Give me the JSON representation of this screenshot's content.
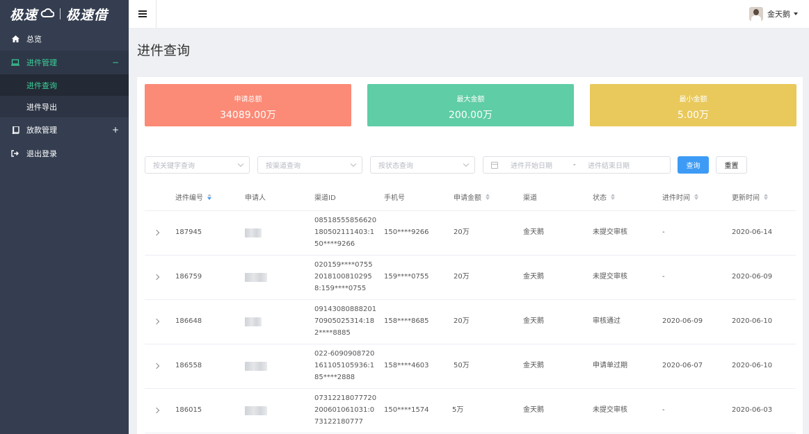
{
  "sidebar": {
    "logo_left": "极速",
    "logo_right": "极速借",
    "items": [
      {
        "label": "总览",
        "icon": "home-icon"
      },
      {
        "label": "进件管理",
        "icon": "laptop-icon",
        "toggle": "−"
      },
      {
        "label": "放款管理",
        "icon": "book-icon",
        "toggle": "+"
      },
      {
        "label": "退出登录",
        "icon": "logout-icon"
      }
    ],
    "sub_items": [
      {
        "label": "进件查询"
      },
      {
        "label": "进件导出"
      }
    ]
  },
  "topbar": {
    "user_name": "金天鹅"
  },
  "page_title": "进件查询",
  "colors": {
    "card_total": "#fb8a76",
    "card_max": "#5fcda6",
    "card_min": "#e9c95b",
    "accent": "#3bd19a",
    "primary_button": "#3e9bf5"
  },
  "summary": {
    "total": {
      "label": "申请总额",
      "value": "34089.00万"
    },
    "max": {
      "label": "最大金额",
      "value": "200.00万"
    },
    "min": {
      "label": "最小金额",
      "value": "5.00万"
    }
  },
  "filters": {
    "keyword_placeholder": "按关键字查询",
    "channel_placeholder": "按渠道查询",
    "status_placeholder": "按状态查询",
    "start_date_placeholder": "进件开始日期",
    "date_separator": "-",
    "end_date_placeholder": "进件结束日期",
    "search_label": "查询",
    "reset_label": "重置"
  },
  "table": {
    "headers": [
      "进件编号",
      "申请人",
      "渠道ID",
      "手机号",
      "申请金额",
      "渠道",
      "状态",
      "进件时间",
      "更新时间"
    ],
    "rows": [
      {
        "id": "187945",
        "channel_id": [
          "08518555856620",
          "180502111403:1",
          "50****9266"
        ],
        "phone": "150****9266",
        "amount": "20万",
        "channel": "金天鹅",
        "status": "未提交审核",
        "submit_time": "-",
        "update_time": "2020-06-14"
      },
      {
        "id": "186759",
        "channel_id": [
          "020159****0755",
          "2018100810295",
          "8:159****0755"
        ],
        "phone": "159****0755",
        "amount": "20万",
        "channel": "金天鹅",
        "status": "未提交审核",
        "submit_time": "-",
        "update_time": "2020-06-09"
      },
      {
        "id": "186648",
        "channel_id": [
          "09143080888201",
          "70905025314:18",
          "2****8885"
        ],
        "phone": "158****8685",
        "amount": "20万",
        "channel": "金天鹅",
        "status": "审核通过",
        "submit_time": "2020-06-09",
        "update_time": "2020-06-10"
      },
      {
        "id": "186558",
        "channel_id": [
          "022-6090908720",
          "161105105936:1",
          "85****2888"
        ],
        "phone": "158****4603",
        "amount": "50万",
        "channel": "金天鹅",
        "status": "申请单过期",
        "submit_time": "2020-06-07",
        "update_time": "2020-06-10"
      },
      {
        "id": "186015",
        "channel_id": [
          "07312218077720",
          "200601061031:0",
          "73122180777"
        ],
        "phone": "150****1574",
        "amount": "5万",
        "channel": "金天鹅",
        "status": "未提交审核",
        "submit_time": "-",
        "update_time": "2020-06-03"
      }
    ]
  }
}
